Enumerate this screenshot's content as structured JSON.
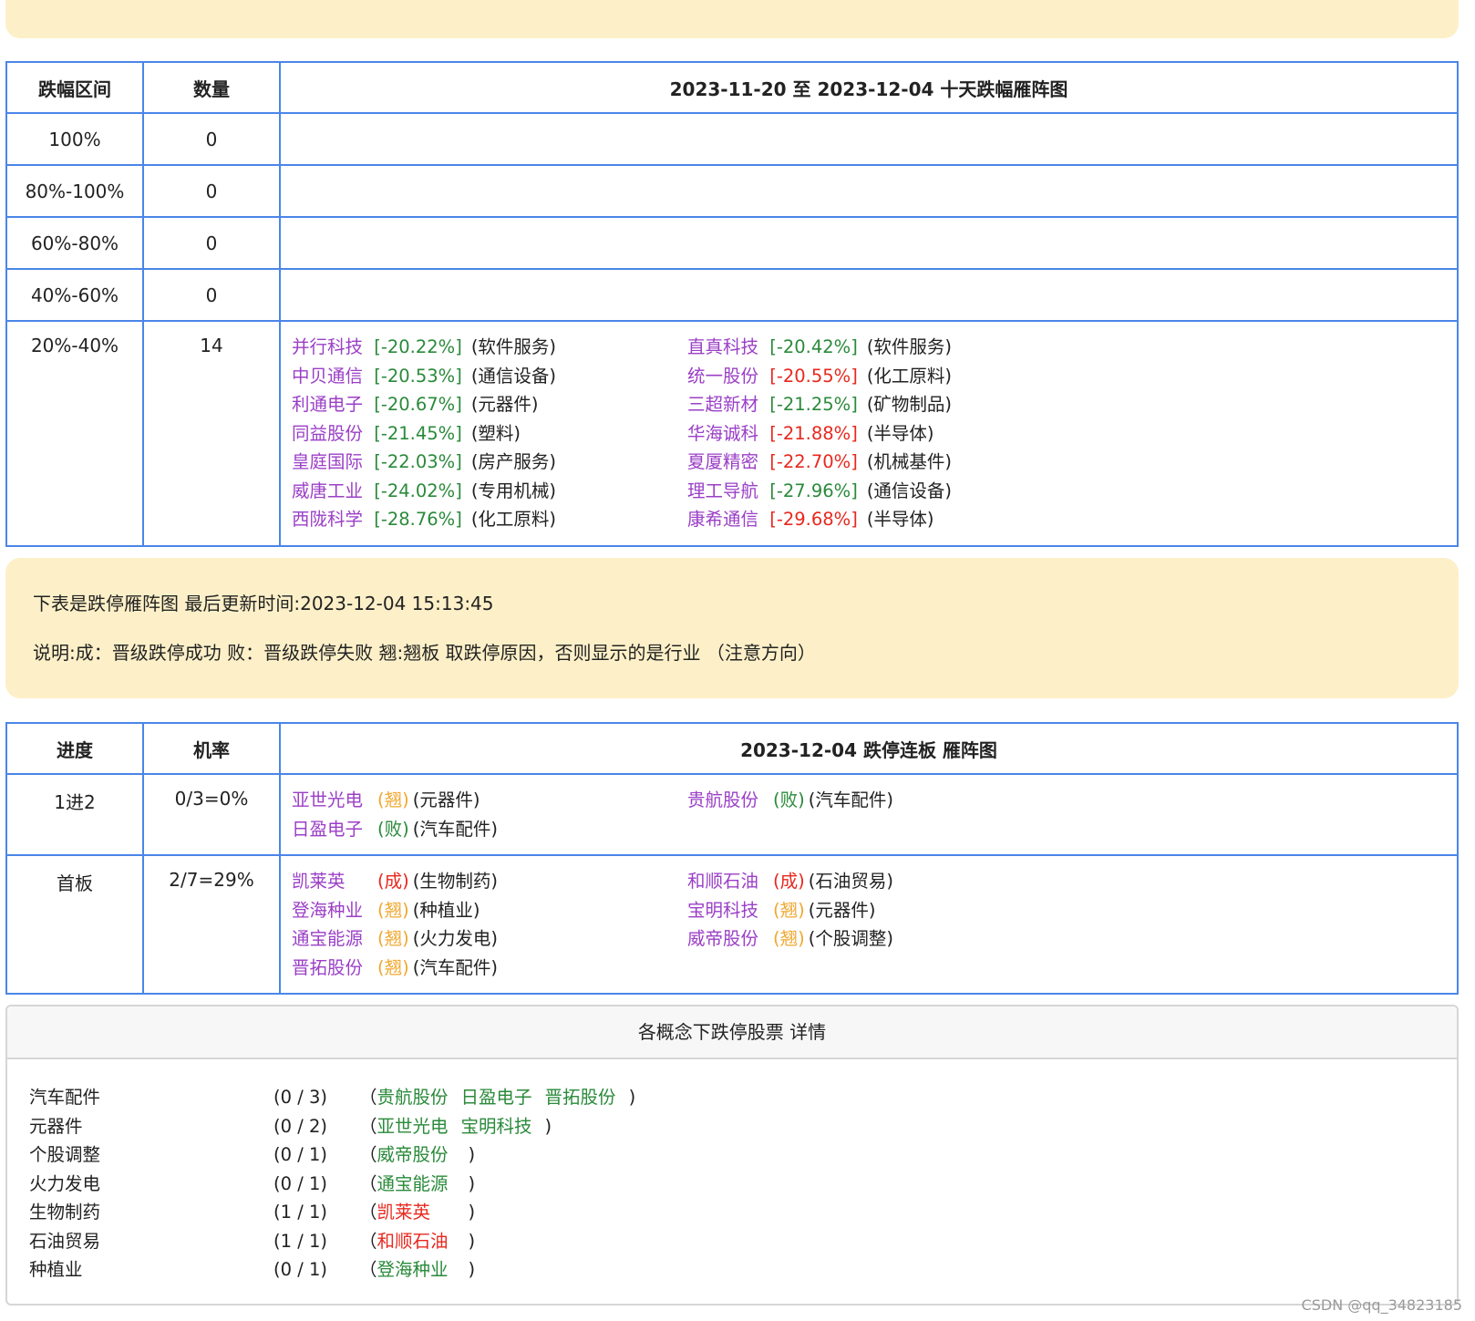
{
  "drop_table": {
    "headers": [
      "跌幅区间",
      "数量",
      "2023-11-20 至 2023-12-04 十天跌幅雁阵图"
    ],
    "rows": [
      {
        "range": "100%",
        "count": "0"
      },
      {
        "range": "80%-100%",
        "count": "0"
      },
      {
        "range": "60%-80%",
        "count": "0"
      },
      {
        "range": "40%-60%",
        "count": "0"
      },
      {
        "range": "20%-40%",
        "count": "14"
      }
    ],
    "stocks": [
      {
        "name": "并行科技",
        "pct": "[-20.22%]",
        "ind": "(软件服务)",
        "color": "green"
      },
      {
        "name": "直真科技",
        "pct": "[-20.42%]",
        "ind": "(软件服务)",
        "color": "green"
      },
      {
        "name": "中贝通信",
        "pct": "[-20.53%]",
        "ind": "(通信设备)",
        "color": "green"
      },
      {
        "name": "统一股份",
        "pct": "[-20.55%]",
        "ind": "(化工原料)",
        "color": "red"
      },
      {
        "name": "利通电子",
        "pct": "[-20.67%]",
        "ind": "(元器件)",
        "color": "green"
      },
      {
        "name": "三超新材",
        "pct": "[-21.25%]",
        "ind": "(矿物制品)",
        "color": "green"
      },
      {
        "name": "同益股份",
        "pct": "[-21.45%]",
        "ind": "(塑料)",
        "color": "green"
      },
      {
        "name": "华海诚科",
        "pct": "[-21.88%]",
        "ind": "(半导体)",
        "color": "red"
      },
      {
        "name": "皇庭国际",
        "pct": "[-22.03%]",
        "ind": "(房产服务)",
        "color": "green"
      },
      {
        "name": "夏厦精密",
        "pct": "[-22.70%]",
        "ind": "(机械基件)",
        "color": "red"
      },
      {
        "name": "威唐工业",
        "pct": "[-24.02%]",
        "ind": "(专用机械)",
        "color": "green"
      },
      {
        "name": "理工导航",
        "pct": "[-27.96%]",
        "ind": "(通信设备)",
        "color": "green"
      },
      {
        "name": "西陇科学",
        "pct": "[-28.76%]",
        "ind": "(化工原料)",
        "color": "green"
      },
      {
        "name": "康希通信",
        "pct": "[-29.68%]",
        "ind": "(半导体)",
        "color": "red"
      }
    ]
  },
  "notice": {
    "line1": "下表是跌停雁阵图 最后更新时间:2023-12-04 15:13:45",
    "line2": "说明:成：晋级跌停成功 败：晋级跌停失败 翘:翘板 取跌停原因，否则显示的是行业 （注意方向）"
  },
  "limit_table": {
    "headers": [
      "进度",
      "机率",
      "2023-12-04 跌停连板 雁阵图"
    ],
    "rows": [
      {
        "stage": "1进2",
        "rate": "0/3=0%",
        "stocks": [
          {
            "name": "亚世光电",
            "tag": "(翘)",
            "tag_color": "orange",
            "ind": "(元器件)"
          },
          {
            "name": "贵航股份",
            "tag": "(败)",
            "tag_color": "green",
            "ind": "(汽车配件)"
          },
          {
            "name": "日盈电子",
            "tag": "(败)",
            "tag_color": "green",
            "ind": "(汽车配件)"
          }
        ]
      },
      {
        "stage": "首板",
        "rate": "2/7=29%",
        "stocks": [
          {
            "name": "凯莱英",
            "tag": "(成)",
            "tag_color": "red",
            "ind": "(生物制药)"
          },
          {
            "name": "和顺石油",
            "tag": "(成)",
            "tag_color": "red",
            "ind": "(石油贸易)"
          },
          {
            "name": "登海种业",
            "tag": "(翘)",
            "tag_color": "orange",
            "ind": "(种植业)"
          },
          {
            "name": "宝明科技",
            "tag": "(翘)",
            "tag_color": "orange",
            "ind": "(元器件)"
          },
          {
            "name": "通宝能源",
            "tag": "(翘)",
            "tag_color": "orange",
            "ind": "(火力发电)"
          },
          {
            "name": "威帝股份",
            "tag": "(翘)",
            "tag_color": "orange",
            "ind": "(个股调整)"
          },
          {
            "name": "晋拓股份",
            "tag": "(翘)",
            "tag_color": "orange",
            "ind": "(汽车配件)"
          }
        ]
      }
    ]
  },
  "detail": {
    "title": "各概念下跌停股票 详情",
    "rows": [
      {
        "concept": "汽车配件",
        "count": "(0 / 3)",
        "stocks": [
          {
            "name": "贵航股份",
            "color": "green"
          },
          {
            "name": "日盈电子",
            "color": "green"
          },
          {
            "name": "晋拓股份",
            "color": "green"
          }
        ]
      },
      {
        "concept": "元器件",
        "count": "(0 / 2)",
        "stocks": [
          {
            "name": "亚世光电",
            "color": "green"
          },
          {
            "name": "宝明科技",
            "color": "green"
          }
        ]
      },
      {
        "concept": "个股调整",
        "count": "(0 / 1)",
        "stocks": [
          {
            "name": "威帝股份",
            "color": "green"
          }
        ]
      },
      {
        "concept": "火力发电",
        "count": "(0 / 1)",
        "stocks": [
          {
            "name": "通宝能源",
            "color": "green"
          }
        ]
      },
      {
        "concept": "生物制药",
        "count": "(1 / 1)",
        "stocks": [
          {
            "name": "凯莱英",
            "color": "red"
          }
        ]
      },
      {
        "concept": "石油贸易",
        "count": "(1 / 1)",
        "stocks": [
          {
            "name": "和顺石油",
            "color": "red"
          }
        ]
      },
      {
        "concept": "种植业",
        "count": "(0 / 1)",
        "stocks": [
          {
            "name": "登海种业",
            "color": "green"
          }
        ]
      }
    ]
  },
  "colors": {
    "green": "#2a8a3a",
    "red": "#e8281e",
    "orange": "#f0a830",
    "purple": "#9b3fc7",
    "border": "#4a86e8",
    "banner": "#fdf0c8"
  },
  "watermark": "CSDN @qq_34823185"
}
